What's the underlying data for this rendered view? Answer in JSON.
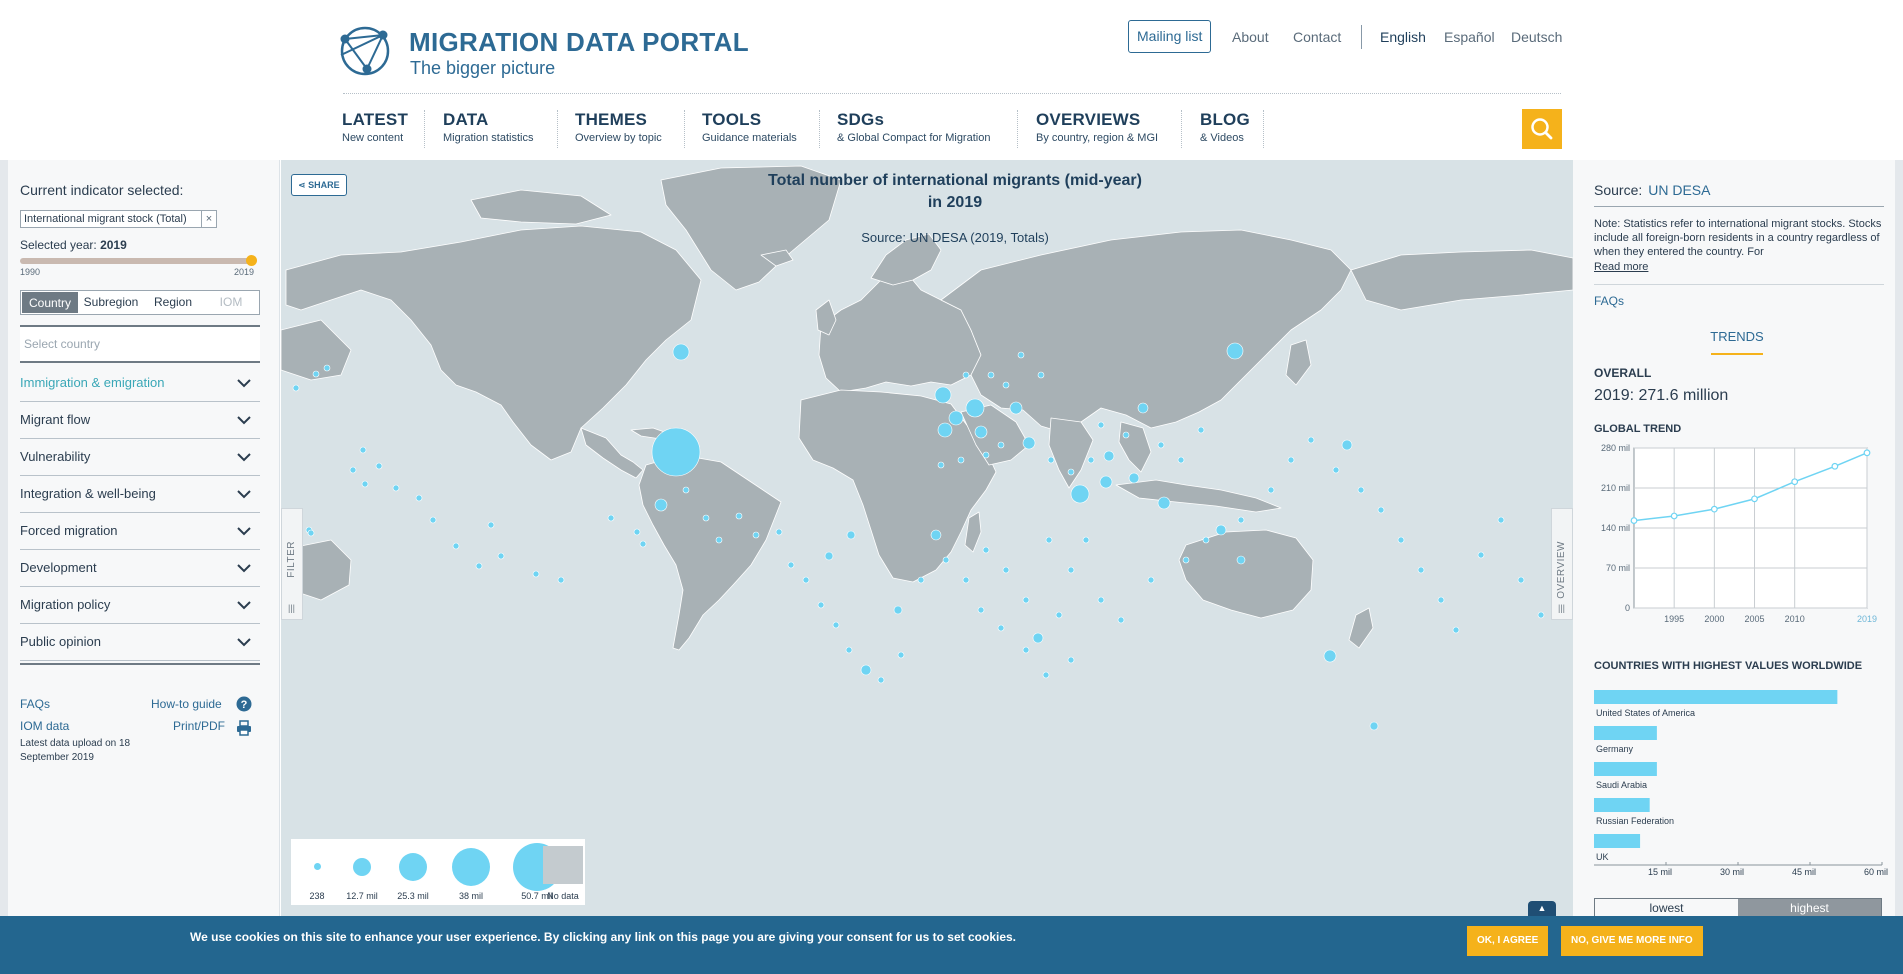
{
  "header": {
    "title": "MIGRATION DATA PORTAL",
    "subtitle": "The bigger picture",
    "mailing_list": "Mailing list",
    "links": [
      "About",
      "Contact"
    ],
    "languages": [
      "English",
      "Español",
      "Deutsch"
    ],
    "active_language": "English"
  },
  "nav": [
    {
      "title": "LATEST",
      "sub": "New content"
    },
    {
      "title": "DATA",
      "sub": "Migration statistics"
    },
    {
      "title": "THEMES",
      "sub": "Overview by topic"
    },
    {
      "title": "TOOLS",
      "sub": "Guidance materials"
    },
    {
      "title": "SDGs",
      "sub": "& Global Compact for Migration"
    },
    {
      "title": "OVERVIEWS",
      "sub": "By country, region & MGI"
    },
    {
      "title": "BLOG",
      "sub": "& Videos"
    }
  ],
  "filter": {
    "current_label": "Current indicator selected:",
    "indicator": "International migrant stock (Total)",
    "year_prefix": "Selected year:",
    "year": "2019",
    "year_min": "1990",
    "year_max": "2019",
    "year_fraction": 1.0,
    "levels": [
      "Country",
      "Subregion",
      "Region",
      "IOM"
    ],
    "active_level": "Country",
    "country_placeholder": "Select country",
    "categories": [
      "Immigration & emigration",
      "Migrant flow",
      "Vulnerability",
      "Integration & well-being",
      "Forced migration",
      "Development",
      "Migration policy",
      "Public opinion"
    ],
    "active_category": "Immigration & emigration",
    "footer_links": {
      "faqs": "FAQs",
      "howto": "How-to guide",
      "iom": "IOM data",
      "print": "Print/PDF"
    },
    "upload_note": "Latest data upload on 18 September 2019"
  },
  "map": {
    "share": "SHARE",
    "title": "Total number of international migrants (mid-year) in 2019",
    "source": "Source: UN DESA (2019, Totals)",
    "filter_tab": "FILTER",
    "overview_tab": "OVERVIEW",
    "bubble_color": "#6fd4f3",
    "legend": [
      "238",
      "12.7 mil",
      "25.3 mil",
      "38 mil",
      "50.7 mil",
      "No data"
    ]
  },
  "overview": {
    "source_label": "Source:",
    "source_value": "UN DESA",
    "note": "Note: Statistics refer to international migrant stocks. Stocks include all foreign-born residents in a country regardless of when they entered the country. For",
    "read_more": "Read more",
    "faqs": "FAQs",
    "tab": "TRENDS",
    "overall_label": "OVERALL",
    "overall_value": "2019: 271.6 million",
    "trend_label": "GLOBAL TREND",
    "top_label": "COUNTRIES WITH HIGHEST VALUES WORLDWIDE",
    "sort": [
      "lowest",
      "highest"
    ],
    "active_sort": "highest"
  },
  "chart_data": [
    {
      "type": "line",
      "title": "GLOBAL TREND",
      "x": [
        "1990",
        "1995",
        "2000",
        "2005",
        "2010",
        "2015",
        "2019"
      ],
      "x_ticks": [
        "1995",
        "2000",
        "2005",
        "2010",
        "2019"
      ],
      "y_ticks": [
        "0",
        "70 mil",
        "140 mil",
        "210 mil",
        "280 mil"
      ],
      "ylim": [
        0,
        280
      ],
      "series": [
        {
          "values": [
            153,
            161,
            173,
            191,
            221,
            248,
            271.6
          ]
        }
      ],
      "grid": true
    },
    {
      "type": "bar",
      "title": "COUNTRIES WITH HIGHEST VALUES WORLDWIDE",
      "categories": [
        "United States of America",
        "Germany",
        "Saudi Arabia",
        "Russian Federation",
        "UK"
      ],
      "values": [
        50.7,
        13.1,
        13.1,
        11.6,
        9.6
      ],
      "x_ticks": [
        "15 mil",
        "30 mil",
        "45 mil",
        "60 mil"
      ],
      "xlim": [
        0,
        60
      ],
      "color": "#6fd4f3"
    }
  ],
  "cookie": {
    "text": "We use cookies on this site to enhance your user experience. By clicking any link on this page you are giving your consent for us to set cookies.",
    "agree": "OK, I AGREE",
    "more": "NO, GIVE ME MORE INFO"
  }
}
